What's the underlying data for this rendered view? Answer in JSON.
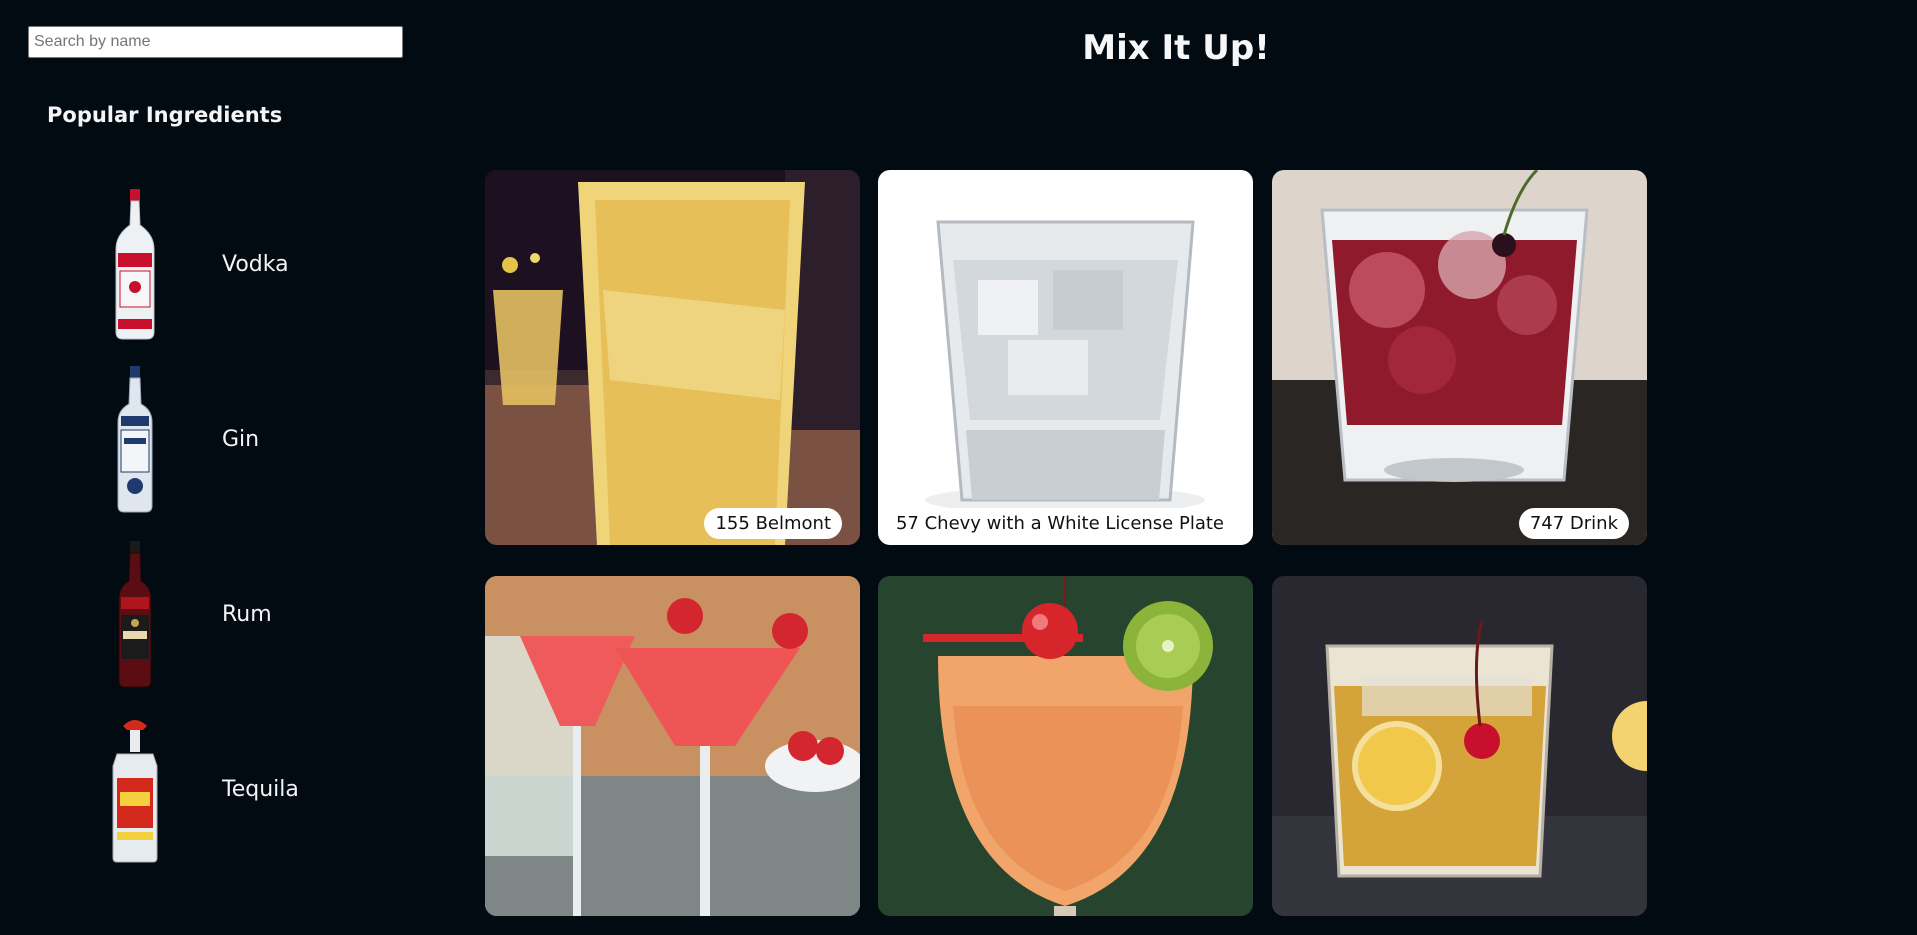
{
  "search": {
    "placeholder": "Search by name",
    "value": ""
  },
  "page": {
    "title": "Mix It Up!"
  },
  "sidebar": {
    "title": "Popular Ingredients",
    "ingredients": [
      {
        "name": "Vodka",
        "icon": "vodka-bottle"
      },
      {
        "name": "Gin",
        "icon": "gin-bottle"
      },
      {
        "name": "Rum",
        "icon": "rum-bottle"
      },
      {
        "name": "Tequila",
        "icon": "tequila-bottle"
      }
    ]
  },
  "drinks": [
    {
      "name": "155 Belmont"
    },
    {
      "name": "57 Chevy with a White License Plate"
    },
    {
      "name": "747 Drink"
    },
    {
      "name": ""
    },
    {
      "name": ""
    },
    {
      "name": ""
    }
  ],
  "colors": {
    "background": "#020a12",
    "text": "#f2f4f6",
    "pill": "#ffffff"
  }
}
